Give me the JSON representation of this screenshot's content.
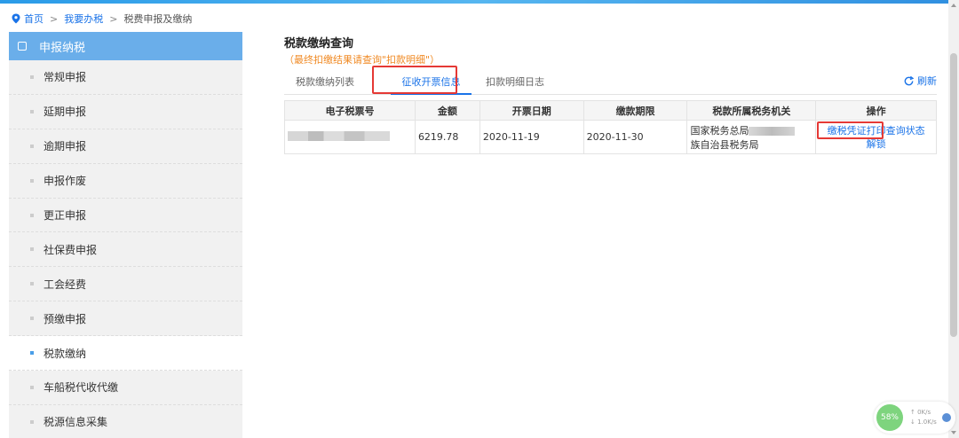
{
  "breadcrumb": {
    "home": "首页",
    "level1": "我要办税",
    "current": "税费申报及缴纳",
    "sep": ">"
  },
  "sidebar": {
    "title": "申报纳税",
    "items": [
      {
        "label": "常规申报"
      },
      {
        "label": "延期申报"
      },
      {
        "label": "逾期申报"
      },
      {
        "label": "申报作废"
      },
      {
        "label": "更正申报"
      },
      {
        "label": "社保费申报"
      },
      {
        "label": "工会经费"
      },
      {
        "label": "预缴申报"
      },
      {
        "label": "税款缴纳",
        "active": true
      },
      {
        "label": "车船税代收代缴"
      },
      {
        "label": "税源信息采集"
      }
    ]
  },
  "main": {
    "title": "税款缴纳查询",
    "note": "（最终扣缴结果请查询\"扣款明细\"）",
    "tabs": [
      {
        "label": "税款缴纳列表"
      },
      {
        "label": "征收开票信息",
        "active": true
      },
      {
        "label": "扣款明细日志"
      }
    ],
    "refresh_label": "刷新",
    "table": {
      "headers": [
        "电子税票号",
        "金额",
        "开票日期",
        "缴款期限",
        "税款所属税务机关",
        "操作"
      ],
      "rows": [
        {
          "amount": "6219.78",
          "issue_date": "2020-11-19",
          "due_date": "2020-11-30",
          "authority_line1": "国家税务总局",
          "authority_line2": "族自治县税务局",
          "op_print": "缴税凭证打印",
          "op_query": "查询状态",
          "op_unlock": "解锁"
        }
      ]
    }
  },
  "net_widget": {
    "percent": "58%",
    "up": "0K/s",
    "down": "1.0K/s"
  },
  "colors": {
    "accent": "#1a73e8",
    "sidebar_head": "#6aaeea",
    "note": "#f08a24",
    "highlight": "#e53935"
  }
}
